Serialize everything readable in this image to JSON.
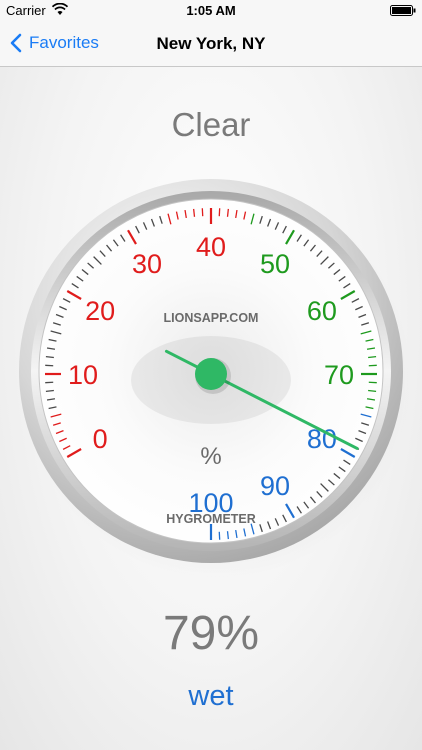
{
  "status_bar": {
    "carrier": "Carrier",
    "time": "1:05 AM",
    "wifi_icon": "wifi-icon",
    "battery_icon": "battery-icon"
  },
  "nav": {
    "back_label": "Favorites",
    "back_icon": "chevron-left-icon",
    "title": "New York, NY",
    "accent": "#1a7cf5"
  },
  "weather": {
    "condition": "Clear"
  },
  "gauge": {
    "brand": "LIONSAPP.COM",
    "unit_symbol": "%",
    "caption": "HYGROMETER",
    "min": 0,
    "max": 100,
    "value": 79,
    "scale_labels": [
      {
        "text": "0",
        "value": 0,
        "color": "#e01c1c"
      },
      {
        "text": "10",
        "value": 10,
        "color": "#e01c1c"
      },
      {
        "text": "20",
        "value": 20,
        "color": "#e01c1c"
      },
      {
        "text": "30",
        "value": 30,
        "color": "#e01c1c"
      },
      {
        "text": "40",
        "value": 40,
        "color": "#e01c1c"
      },
      {
        "text": "50",
        "value": 50,
        "color": "#1e9a1e"
      },
      {
        "text": "60",
        "value": 60,
        "color": "#1e9a1e"
      },
      {
        "text": "70",
        "value": 70,
        "color": "#1e9a1e"
      },
      {
        "text": "80",
        "value": 80,
        "color": "#1f6fd1"
      },
      {
        "text": "90",
        "value": 90,
        "color": "#1f6fd1"
      },
      {
        "text": "100",
        "value": 100,
        "color": "#1f6fd1"
      }
    ],
    "zone_colors": {
      "dry": "#e01c1c",
      "normal": "#1e9a1e",
      "wet": "#1f6fd1",
      "needle": "#2fb865"
    }
  },
  "readout": {
    "value": "79%",
    "state": "wet"
  }
}
